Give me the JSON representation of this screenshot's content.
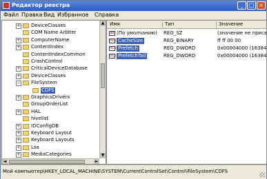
{
  "window": {
    "title": "Редактор реестра"
  },
  "menubar": [
    "Файл",
    "Правка",
    "Вид",
    "Избранное",
    "Справка"
  ],
  "tree": [
    {
      "label": "DeviceClasses",
      "depth": 1,
      "expander": "+"
    },
    {
      "label": "COM Name Arbiter",
      "depth": 1,
      "expander": ""
    },
    {
      "label": "ComputerName",
      "depth": 1,
      "expander": "+"
    },
    {
      "label": "ContentIndex",
      "depth": 1,
      "expander": "+"
    },
    {
      "label": "ContentIndexCommon",
      "depth": 1,
      "expander": ""
    },
    {
      "label": "CrashControl",
      "depth": 1,
      "expander": ""
    },
    {
      "label": "CriticalDeviceDatabase",
      "depth": 1,
      "expander": "+"
    },
    {
      "label": "DeviceClasses",
      "depth": 1,
      "expander": "+"
    },
    {
      "label": "FileSystem",
      "depth": 1,
      "expander": "−"
    },
    {
      "label": "CDFS",
      "depth": 2,
      "expander": "",
      "selected": true
    },
    {
      "label": "GraphicsDrivers",
      "depth": 1,
      "expander": "+"
    },
    {
      "label": "GroupOrderList",
      "depth": 1,
      "expander": ""
    },
    {
      "label": "HAL",
      "depth": 1,
      "expander": "+"
    },
    {
      "label": "hivelist",
      "depth": 1,
      "expander": ""
    },
    {
      "label": "IDConfigDB",
      "depth": 1,
      "expander": "+"
    },
    {
      "label": "Keyboard Layout",
      "depth": 1,
      "expander": "+"
    },
    {
      "label": "Keyboard Layouts",
      "depth": 1,
      "expander": "+"
    },
    {
      "label": "Lsa",
      "depth": 1,
      "expander": "+"
    },
    {
      "label": "MediaCategories",
      "depth": 1,
      "expander": "+"
    }
  ],
  "columns": [
    "Имя",
    "Тип",
    "Значение"
  ],
  "values": [
    {
      "name": "(По умолчанию)",
      "type": "REG_SZ",
      "data": "(значение не присвоено)",
      "icon": "ab",
      "selected": false
    },
    {
      "name": "CacheSize",
      "type": "REG_BINARY",
      "data": "ff ff 00 00",
      "icon": "011",
      "selected": true
    },
    {
      "name": "Prefetch",
      "type": "REG_DWORD",
      "data": "0x00004000 (16384)",
      "icon": "011",
      "selected": true
    },
    {
      "name": "PrefetchTail",
      "type": "REG_DWORD",
      "data": "0x00004000 (16384)",
      "icon": "011",
      "selected": true
    }
  ],
  "status": {
    "path": "Мой компьютер\\HKEY_LOCAL_MACHINE\\SYSTEM\\CurrentControlSet\\Control\\FileSystem\\CDFS"
  },
  "colors": {
    "titlebar": "#2c5bc4",
    "selection": "#3a60b4",
    "folder": "#f4d46c"
  }
}
